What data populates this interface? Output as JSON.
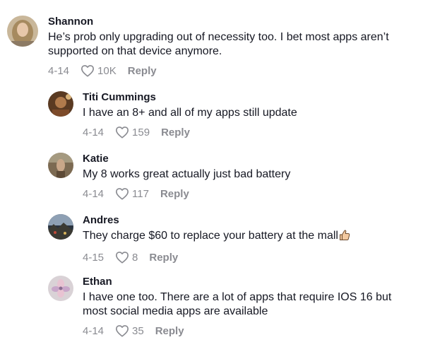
{
  "comments": [
    {
      "username": "Shannon",
      "text": "He’s prob only upgrading out of necessity too. I bet most apps aren’t supported on that device anymore.",
      "date": "4-14",
      "likes": "10K",
      "reply_label": "Reply",
      "avatar_icon": "user-avatar-photo"
    },
    {
      "username": "Titi Cummings",
      "text": "I have an 8+ and all of my apps still update",
      "date": "4-14",
      "likes": "159",
      "reply_label": "Reply",
      "avatar_icon": "user-avatar-photo"
    },
    {
      "username": "Katie",
      "text": "My 8 works great actually just bad battery",
      "date": "4-14",
      "likes": "117",
      "reply_label": "Reply",
      "avatar_icon": "user-avatar-photo"
    },
    {
      "username": "Andres",
      "text": "They charge $60 to replace your battery at the mall",
      "emoji_icon": "thumbs-up-emoji",
      "date": "4-15",
      "likes": "8",
      "reply_label": "Reply",
      "avatar_icon": "user-avatar-photo"
    },
    {
      "username": "Ethan",
      "text": "I have one too. There are a lot of apps that require IOS 16 but most social media apps are available",
      "date": "4-14",
      "likes": "35",
      "reply_label": "Reply",
      "avatar_icon": "user-avatar-photo"
    }
  ],
  "colors": {
    "text": "#161823",
    "meta": "#8a8b91",
    "background": "#ffffff"
  }
}
